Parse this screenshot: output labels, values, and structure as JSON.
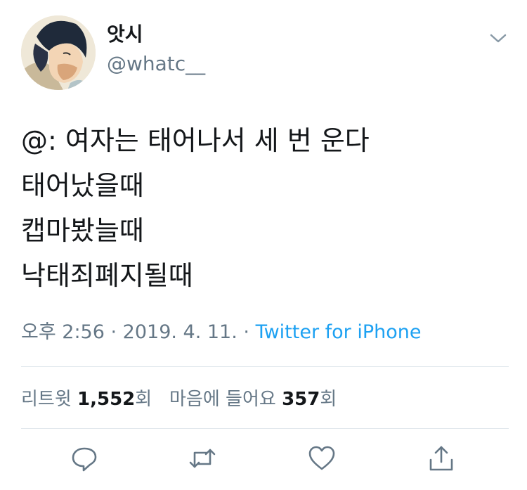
{
  "user": {
    "display_name": "앗시",
    "handle": "@whatc__"
  },
  "tweet": {
    "lines": [
      "@: 여자는 태어나서 세 번 운다",
      "태어났을때",
      "캡마봤늘때",
      "낙태죄폐지될때"
    ]
  },
  "meta": {
    "time": "오후 2:56",
    "sep1": " · ",
    "date": "2019. 4. 11.",
    "sep2": " · ",
    "source": "Twitter for iPhone"
  },
  "stats": {
    "retweet_label": "리트윗",
    "retweet_count": "1,552",
    "retweet_unit": "회",
    "like_label": "마음에 들어요",
    "like_count": "357",
    "like_unit": "회"
  },
  "icons": {
    "reply": "reply-icon",
    "retweet": "retweet-icon",
    "like": "heart-icon",
    "share": "share-icon",
    "menu": "chevron-down-icon"
  },
  "colors": {
    "text": "#14171a",
    "secondary": "#657786",
    "link": "#1da1f2",
    "divider": "#e1e8ed"
  }
}
